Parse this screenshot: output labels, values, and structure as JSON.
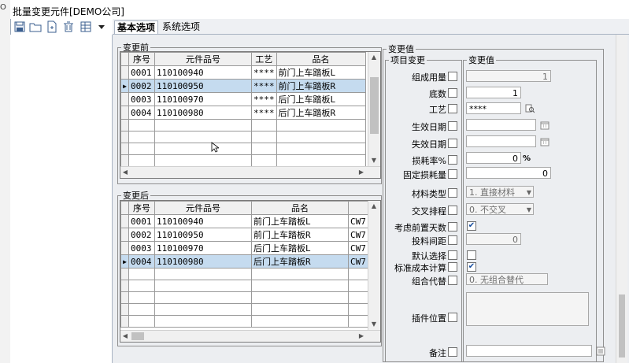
{
  "window": {
    "title": "批量变更元件[DEMO公司]",
    "left_edge_text": "O"
  },
  "toolbar": {
    "icons": [
      "save-icon",
      "open-folder-icon",
      "new-doc-icon",
      "delete-icon",
      "grid-icon",
      "dropdown-arrow-icon"
    ]
  },
  "tabs": [
    {
      "label": "基本选项",
      "active": true
    },
    {
      "label": "系统选项",
      "active": false
    }
  ],
  "before": {
    "legend": "变更前",
    "columns": [
      "序号",
      "元件品号",
      "工艺",
      "品名"
    ],
    "rows": [
      {
        "seq": "0001",
        "part": "110100940",
        "proc": "****",
        "name": "前门上车踏板L",
        "selected": false
      },
      {
        "seq": "0002",
        "part": "110100950",
        "proc": "****",
        "name": "前门上车踏板R",
        "selected": true
      },
      {
        "seq": "0003",
        "part": "110100970",
        "proc": "****",
        "name": "后门上车踏板L",
        "selected": false
      },
      {
        "seq": "0004",
        "part": "110100980",
        "proc": "****",
        "name": "后门上车踏板R",
        "selected": false
      }
    ]
  },
  "after": {
    "legend": "变更后",
    "columns": [
      "序号",
      "元件品号",
      "品名"
    ],
    "overflow_text": "CW7",
    "rows": [
      {
        "seq": "0001",
        "part": "110100940",
        "name": "前门上车踏板L",
        "selected": false
      },
      {
        "seq": "0002",
        "part": "110100950",
        "name": "前门上车踏板R",
        "selected": false
      },
      {
        "seq": "0003",
        "part": "110100970",
        "name": "后门上车踏板L",
        "selected": false
      },
      {
        "seq": "0004",
        "part": "110100980",
        "name": "后门上车踏板R",
        "selected": true
      }
    ]
  },
  "change": {
    "legend": "变更值",
    "col_item": "项目变更",
    "col_value": "变更值",
    "fields": [
      {
        "label": "组成用量",
        "checked": false,
        "value": "1"
      },
      {
        "label": "底数",
        "checked": false,
        "value": "1"
      },
      {
        "label": "工艺",
        "checked": false,
        "value": "****"
      },
      {
        "label": "生效日期",
        "checked": false,
        "value": ""
      },
      {
        "label": "失效日期",
        "checked": false,
        "value": ""
      },
      {
        "label": "损耗率%",
        "checked": false,
        "value": "0",
        "suffix": "%"
      },
      {
        "label": "固定损耗量",
        "checked": false,
        "value": "0"
      },
      {
        "label": "材料类型",
        "checked": false,
        "value": "1. 直接材料"
      },
      {
        "label": "交叉排程",
        "checked": false,
        "value": "0. 不交叉"
      },
      {
        "label": "考虑前置天数",
        "checked": false,
        "value_checked": true
      },
      {
        "label": "投料间距",
        "checked": false,
        "value": "0"
      },
      {
        "label": "默认选择",
        "checked": false,
        "value_checked": false
      },
      {
        "label": "标准成本计算",
        "checked": false,
        "value_checked": true
      },
      {
        "label": "组合代替",
        "checked": false,
        "value": "0. 无组合替代"
      },
      {
        "label": "插件位置",
        "checked": false,
        "value": ""
      },
      {
        "label": "备注",
        "checked": false,
        "value": ""
      }
    ]
  }
}
